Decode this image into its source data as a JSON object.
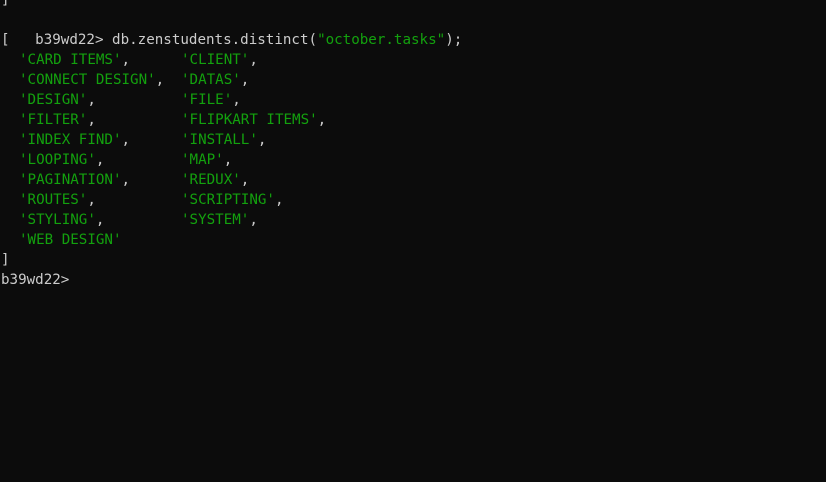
{
  "terminal": {
    "colors": {
      "background": "#0c0c0c",
      "text": "#cccccc",
      "string": "#13a10e"
    },
    "top_partial": "]",
    "prompt": "b39wd22>",
    "command": {
      "prefix": " db.zenstudents.distinct(",
      "argument": "\"october.tasks\"",
      "suffix": ");"
    },
    "open_bracket": "[",
    "results": [
      {
        "left": "'CARD ITEMS'",
        "left_sep": ",",
        "right": "'CLIENT'",
        "right_sep": ","
      },
      {
        "left": "'CONNECT DESIGN'",
        "left_sep": ",",
        "right": "'DATAS'",
        "right_sep": ","
      },
      {
        "left": "'DESIGN'",
        "left_sep": ",",
        "right": "'FILE'",
        "right_sep": ","
      },
      {
        "left": "'FILTER'",
        "left_sep": ",",
        "right": "'FLIPKART ITEMS'",
        "right_sep": ","
      },
      {
        "left": "'INDEX FIND'",
        "left_sep": ",",
        "right": "'INSTALL'",
        "right_sep": ","
      },
      {
        "left": "'LOOPING'",
        "left_sep": ",",
        "right": "'MAP'",
        "right_sep": ","
      },
      {
        "left": "'PAGINATION'",
        "left_sep": ",",
        "right": "'REDUX'",
        "right_sep": ","
      },
      {
        "left": "'ROUTES'",
        "left_sep": ",",
        "right": "'SCRIPTING'",
        "right_sep": ","
      },
      {
        "left": "'STYLING'",
        "left_sep": ",",
        "right": "'SYSTEM'",
        "right_sep": ","
      },
      {
        "left": "'WEB DESIGN'",
        "left_sep": "",
        "right": "",
        "right_sep": ""
      }
    ],
    "close_bracket": "]",
    "final_prompt": "b39wd22>"
  }
}
